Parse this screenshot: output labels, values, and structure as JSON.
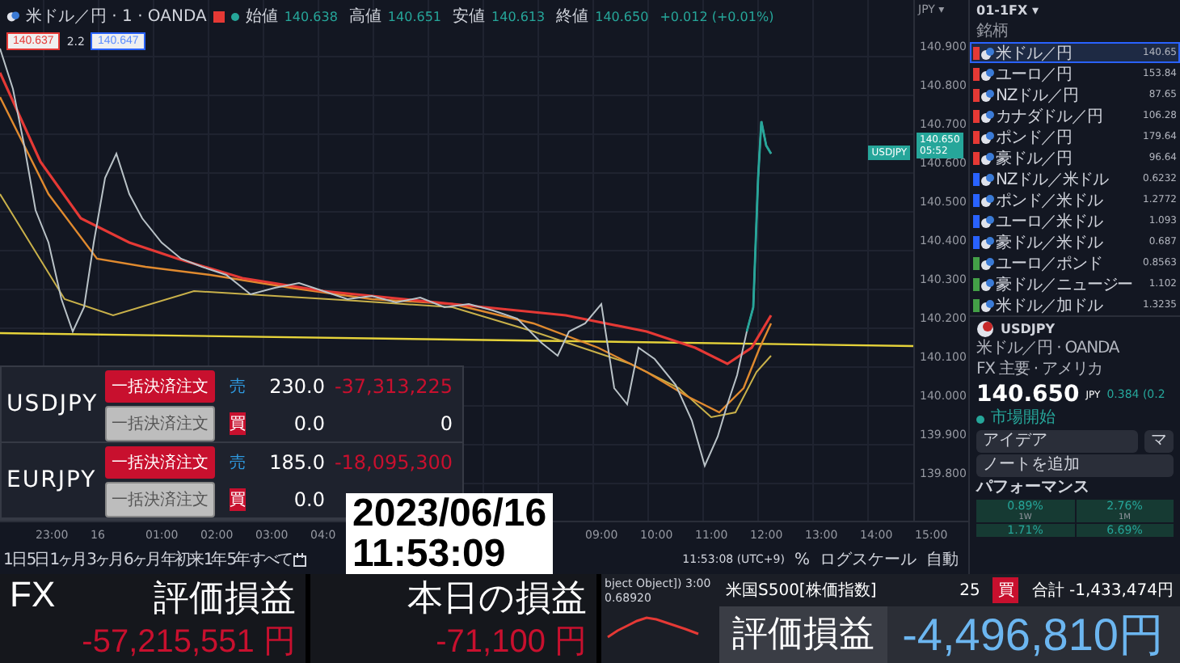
{
  "legend": {
    "symbol": "米ドル／円 · 1 · OANDA",
    "ohlc": [
      {
        "label": "始値",
        "value": "140.638"
      },
      {
        "label": "高値",
        "value": "140.651"
      },
      {
        "label": "安値",
        "value": "140.613"
      },
      {
        "label": "終値",
        "value": "140.650"
      }
    ],
    "change": "+0.012 (+0.01%)",
    "sell_price": "140.637",
    "spread": "2.2",
    "buy_price": "140.647"
  },
  "price_axis": {
    "currency": "JPY ▾",
    "labels": [
      "140.900",
      "140.800",
      "140.700",
      "140.600",
      "140.500",
      "140.400",
      "140.300",
      "140.200",
      "140.100",
      "140.000",
      "139.900",
      "139.800"
    ],
    "last_price_tag": {
      "symbol": "USDJPY",
      "price": "140.650",
      "countdown": "05:52"
    }
  },
  "time_axis": [
    "23:00",
    "16",
    "01:00",
    "02:00",
    "03:00",
    "04:0",
    "09:00",
    "10:00",
    "11:00",
    "12:00",
    "13:00",
    "14:00",
    "15:00"
  ],
  "range_buttons": [
    "1日",
    "5日",
    "1ヶ月",
    "3ヶ月",
    "6ヶ月",
    "年初来",
    "1年",
    "5年",
    "すべて"
  ],
  "chart_footer": {
    "time": "11:53:08 (UTC+9)",
    "percent": "%",
    "log": "ログスケール",
    "auto": "自動"
  },
  "watchlist": {
    "title": "01-1FX ▾",
    "column": "銘柄",
    "rows": [
      {
        "name": "米ドル／円",
        "price": "140.65",
        "color": "#e53935",
        "selected": true
      },
      {
        "name": "ユーロ／円",
        "price": "153.84",
        "color": "#e53935",
        "selected": false
      },
      {
        "name": "NZドル／円",
        "price": "87.65",
        "color": "#e53935",
        "selected": false
      },
      {
        "name": "カナダドル／円",
        "price": "106.28",
        "color": "#e53935",
        "selected": false
      },
      {
        "name": "ポンド／円",
        "price": "179.64",
        "color": "#e53935",
        "selected": false
      },
      {
        "name": "豪ドル／円",
        "price": "96.64",
        "color": "#e53935",
        "selected": false
      },
      {
        "name": "NZドル／米ドル",
        "price": "0.6232",
        "color": "#2962ff",
        "selected": false
      },
      {
        "name": "ポンド／米ドル",
        "price": "1.2772",
        "color": "#2962ff",
        "selected": false
      },
      {
        "name": "ユーロ／米ドル",
        "price": "1.093",
        "color": "#2962ff",
        "selected": false
      },
      {
        "name": "豪ドル／米ドル",
        "price": "0.687",
        "color": "#2962ff",
        "selected": false
      },
      {
        "name": "ユーロ／ポンド",
        "price": "0.8563",
        "color": "#43a047",
        "selected": false
      },
      {
        "name": "豪ドル／ニュージー",
        "price": "1.102",
        "color": "#43a047",
        "selected": false
      },
      {
        "name": "米ドル／加ドル",
        "price": "1.3235",
        "color": "#43a047",
        "selected": false
      }
    ]
  },
  "details": {
    "symbol": "USDJPY",
    "name": "米ドル／円 · OANDA",
    "category": "FX 主要 · アメリカ",
    "price": "140.650",
    "currency": "JPY",
    "change": "0.384",
    "change_pct": "(0.2",
    "status": "市場開始",
    "ideas": "アイデア",
    "other": "マ",
    "note": "ノートを追加",
    "performance_title": "パフォーマンス",
    "performance": [
      {
        "value": "0.89%",
        "period": "1W"
      },
      {
        "value": "2.76%",
        "period": "1M"
      },
      {
        "value": "1.71%"
      },
      {
        "value": "6.69%"
      }
    ]
  },
  "positions": [
    {
      "symbol": "USDJPY",
      "rows": [
        {
          "kind": "sell",
          "button": "一括決済注文",
          "active": true,
          "side": "売",
          "lots": "230.0",
          "pl": "-37,313,225",
          "loss": true
        },
        {
          "kind": "buy",
          "button": "一括決済注文",
          "active": false,
          "side": "買",
          "lots": "0.0",
          "pl": "0",
          "loss": false
        }
      ]
    },
    {
      "symbol": "EURJPY",
      "rows": [
        {
          "kind": "sell",
          "button": "一括決済注文",
          "active": true,
          "side": "売",
          "lots": "185.0",
          "pl": "-18,095,300",
          "loss": true
        },
        {
          "kind": "buy",
          "button": "一括決済注文",
          "active": false,
          "side": "買",
          "lots": "0.0"
        }
      ]
    }
  ],
  "timestamp": {
    "date": "2023/06/16",
    "time": "11:53:09"
  },
  "summary": {
    "fx_label": "FX",
    "fx_title": "評価損益",
    "fx_value": "-57,215,551 円",
    "today_title": "本日の損益",
    "today_value": "-71,100 円",
    "mini_chart": {
      "caption": "bject Object]) 3:00",
      "value": "0.68920"
    },
    "index_name": "米国S500[株価指数]",
    "index_lots": "25",
    "index_side": {
      "kind": "buy",
      "label": "買"
    },
    "total": "合計 -1,433,474円",
    "index_title": "評価損益",
    "index_value": "-4,496,810円"
  }
}
